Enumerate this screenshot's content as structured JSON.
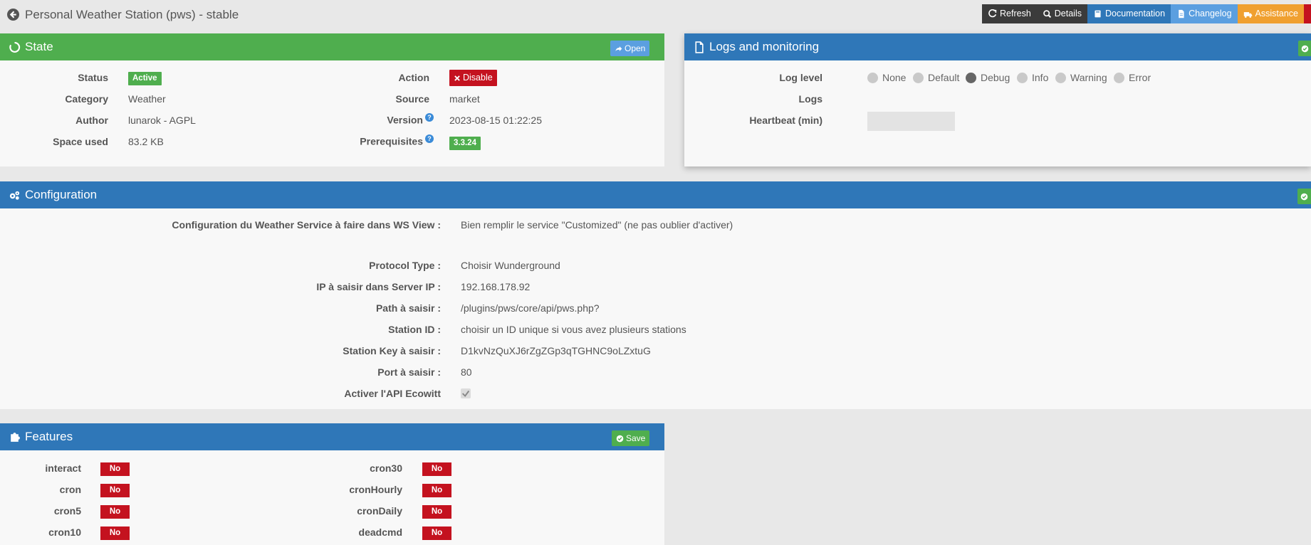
{
  "header": {
    "title": "Personal Weather Station (pws) - stable",
    "buttons": [
      {
        "label": "Refresh",
        "color": "#3b3b3b"
      },
      {
        "label": "Details",
        "color": "#3b3b3b"
      },
      {
        "label": "Documentation",
        "color": "#2f77b8"
      },
      {
        "label": "Changelog",
        "color": "#5b9fe0"
      },
      {
        "label": "Assistance",
        "color": "#f0a030"
      }
    ]
  },
  "state": {
    "title": "State",
    "open_label": "Open",
    "status_label": "Status",
    "status_value": "Active",
    "category_label": "Category",
    "category_value": "Weather",
    "author_label": "Author",
    "author_value": "lunarok - AGPL",
    "space_label": "Space used",
    "space_value": "83.2 KB",
    "action_label": "Action",
    "action_value": "Disable",
    "source_label": "Source",
    "source_value": "market",
    "version_label": "Version",
    "version_value": "2023-08-15 01:22:25",
    "prereq_label": "Prerequisites",
    "prereq_value": "3.3.24"
  },
  "logs": {
    "title": "Logs and monitoring",
    "loglevel_label": "Log level",
    "levels": [
      "None",
      "Default",
      "Debug",
      "Info",
      "Warning",
      "Error"
    ],
    "selected_level": "Debug",
    "logs_label": "Logs",
    "heartbeat_label": "Heartbeat (min)",
    "heartbeat_value": ""
  },
  "config": {
    "title": "Configuration",
    "rows": [
      {
        "label": "Configuration du Weather Service à faire dans WS View :",
        "value": "Bien remplir le service \"Customized\" (ne pas oublier d'activer)"
      },
      {
        "label": "Protocol Type :",
        "value": "Choisir Wunderground"
      },
      {
        "label": "IP à saisir dans Server IP :",
        "value": "192.168.178.92"
      },
      {
        "label": "Path à saisir :",
        "value": "/plugins/pws/core/api/pws.php?"
      },
      {
        "label": "Station ID :",
        "value": "choisir un ID unique si vous avez plusieurs stations"
      },
      {
        "label": "Station Key à saisir :",
        "value": "D1kvNzQuXJ6rZgZGp3qTGHNC9oLZxtuG"
      },
      {
        "label": "Port à saisir :",
        "value": "80"
      },
      {
        "label": "Activer l'API Ecowitt",
        "value": ""
      }
    ]
  },
  "features": {
    "title": "Features",
    "save_label": "Save",
    "left": [
      {
        "label": "interact",
        "value": "No"
      },
      {
        "label": "cron",
        "value": "No"
      },
      {
        "label": "cron5",
        "value": "No"
      },
      {
        "label": "cron10",
        "value": "No"
      }
    ],
    "right": [
      {
        "label": "cron30",
        "value": "No"
      },
      {
        "label": "cronHourly",
        "value": "No"
      },
      {
        "label": "cronDaily",
        "value": "No"
      },
      {
        "label": "deadcmd",
        "value": "No"
      }
    ]
  }
}
